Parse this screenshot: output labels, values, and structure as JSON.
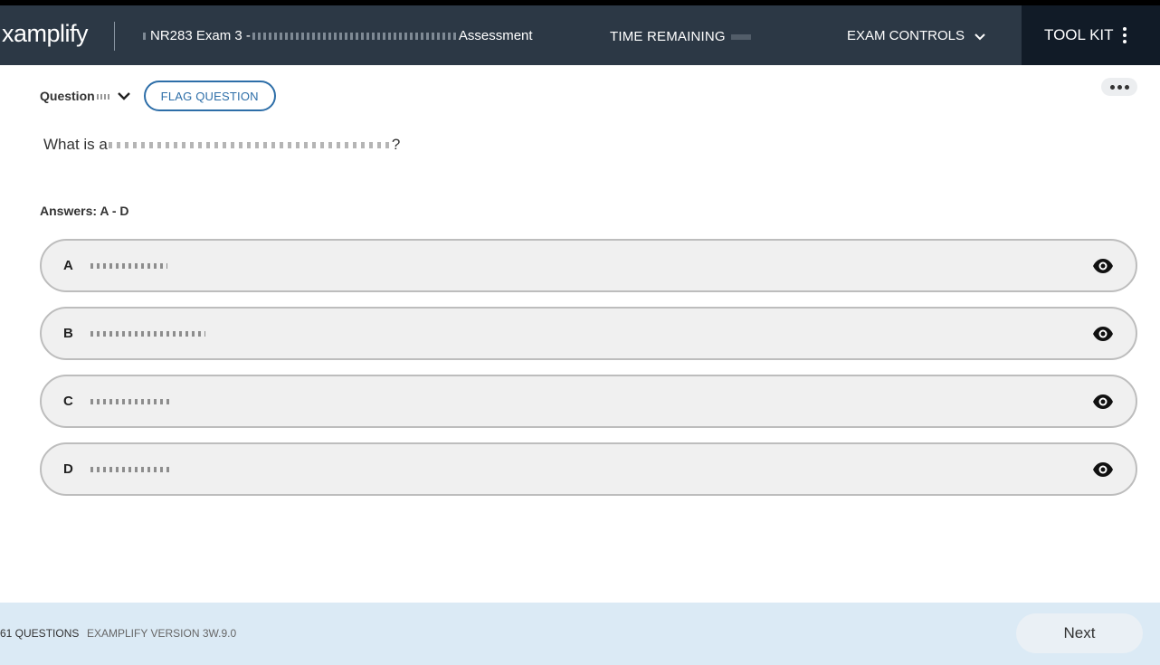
{
  "header": {
    "logo": "xamplify",
    "exam_title_prefix": "NR283 Exam 3 -",
    "exam_title_suffix": "Assessment",
    "time_remaining_label": "TIME REMAINING",
    "exam_controls_label": "EXAM CONTROLS",
    "toolkit_label": "TOOL KIT"
  },
  "question": {
    "label": "Question",
    "flag_label": "FLAG QUESTION",
    "text_prefix": "What is a",
    "text_suffix": "?",
    "answers_label": "Answers: A - D"
  },
  "options": [
    {
      "letter": "A",
      "blur_fraction": 0.07
    },
    {
      "letter": "B",
      "blur_fraction": 0.105
    },
    {
      "letter": "C",
      "blur_fraction": 0.072
    },
    {
      "letter": "D",
      "blur_fraction": 0.072
    }
  ],
  "footer": {
    "question_count": "61 QUESTIONS",
    "version": "EXAMPLIFY VERSION 3W.9.0",
    "next_label": "Next"
  },
  "colors": {
    "header_bg": "#2c3845",
    "toolkit_bg": "#111b27",
    "accent": "#2d6ea8",
    "footer_bg": "#dbeaf5",
    "option_bg": "#f0f0f0"
  }
}
